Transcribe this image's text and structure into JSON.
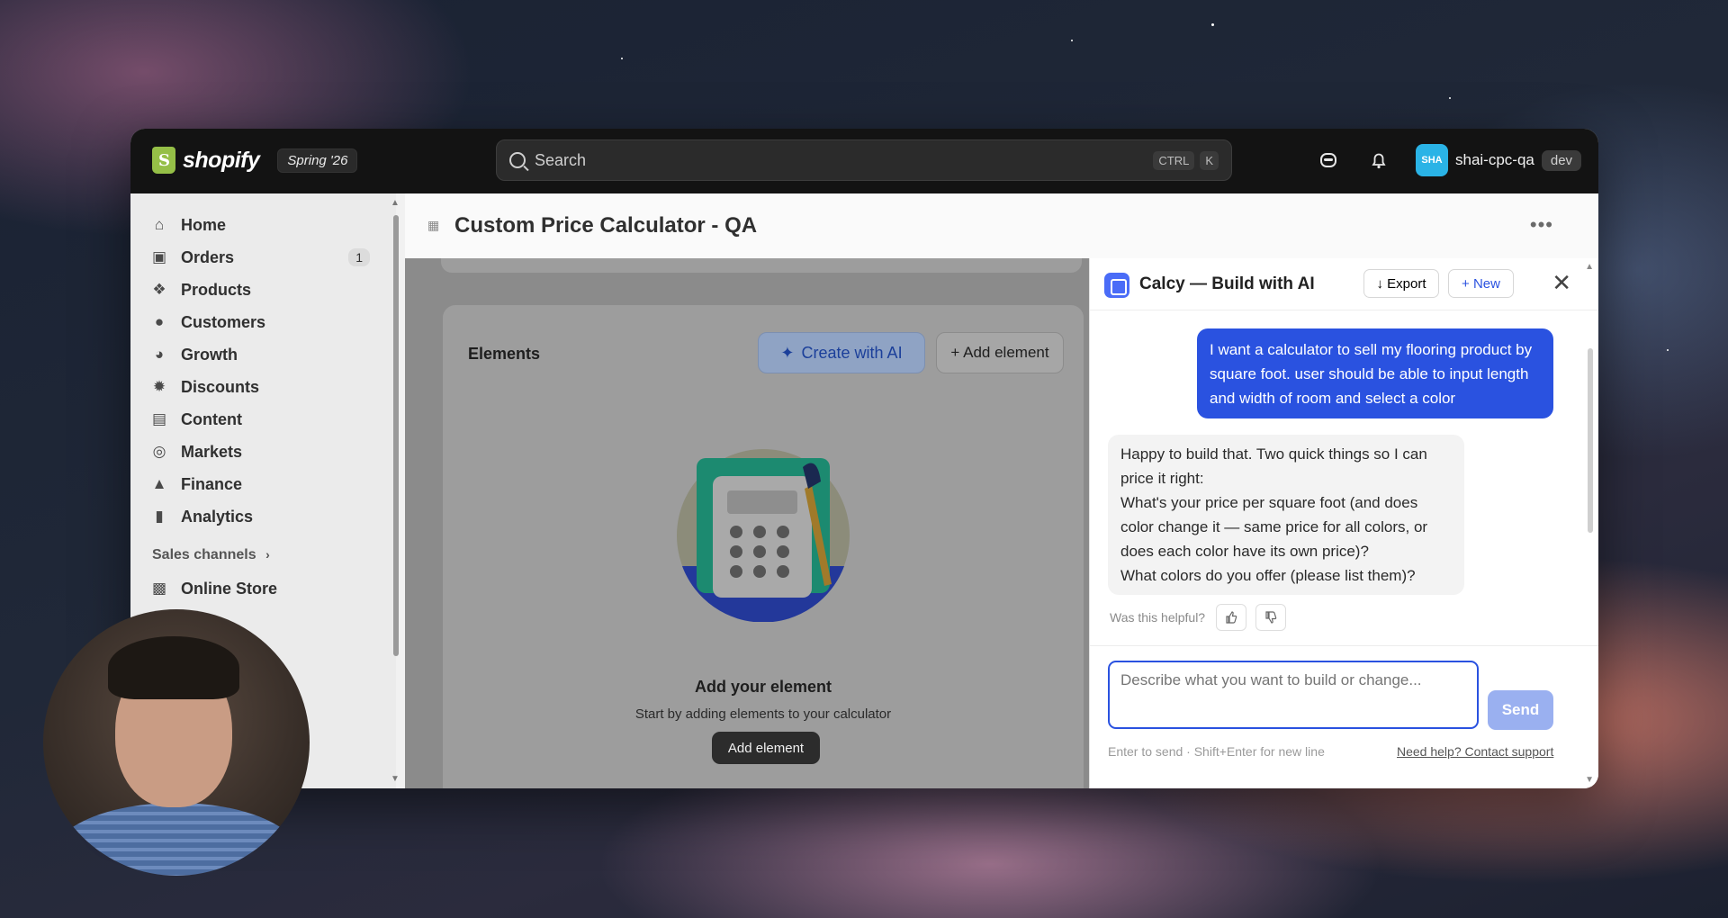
{
  "topbar": {
    "logo_text": "shopify",
    "edition": "Spring '26",
    "search_placeholder": "Search",
    "kbd_ctrl": "CTRL",
    "kbd_k": "K",
    "account_initials": "SHA",
    "account_name": "shai-cpc-qa",
    "account_badge": "dev"
  },
  "sidebar": {
    "items": [
      {
        "label": "Home",
        "icon": "home-icon"
      },
      {
        "label": "Orders",
        "icon": "orders-icon",
        "badge": "1"
      },
      {
        "label": "Products",
        "icon": "tag-icon"
      },
      {
        "label": "Customers",
        "icon": "person-icon"
      },
      {
        "label": "Growth",
        "icon": "gauge-icon"
      },
      {
        "label": "Discounts",
        "icon": "discount-icon"
      },
      {
        "label": "Content",
        "icon": "content-icon"
      },
      {
        "label": "Markets",
        "icon": "globe-icon"
      },
      {
        "label": "Finance",
        "icon": "bank-icon"
      },
      {
        "label": "Analytics",
        "icon": "bar-chart-icon"
      }
    ],
    "sales_channels_label": "Sales channels",
    "sales_channels": [
      {
        "label": "Online Store",
        "icon": "store-icon"
      }
    ]
  },
  "page": {
    "title": "Custom Price Calculator - QA",
    "more_label": "•••"
  },
  "editor": {
    "elements_title": "Elements",
    "create_ai_label": "Create with AI",
    "add_element_label": "+ Add element",
    "empty_title": "Add your element",
    "empty_subtitle": "Start by adding elements to your calculator",
    "empty_button": "Add element"
  },
  "ai_panel": {
    "title": "Calcy — Build with AI",
    "export_label": "↓ Export",
    "new_label": "+ New",
    "close_label": "✕",
    "user_message": "I want a calculator to sell my flooring product by square foot. user should be able to input length and width of room and select a color",
    "bot_message_lines": [
      "Happy to build that. Two quick things so I can price it right:",
      "What's your price per square foot (and does color change it — same price for all colors, or does each color have its own price)?",
      "What colors do you offer (please list them)?"
    ],
    "helpful_label": "Was this helpful?",
    "composer_placeholder": "Describe what you want to build or change...",
    "send_label": "Send",
    "hint": "Enter to send · Shift+Enter for new line",
    "support_link": "Need help? Contact support"
  },
  "colors": {
    "accent": "#2a52e0",
    "topbar": "#131313",
    "sidebar": "#ebebeb",
    "overlay": "#8b8b8b"
  }
}
